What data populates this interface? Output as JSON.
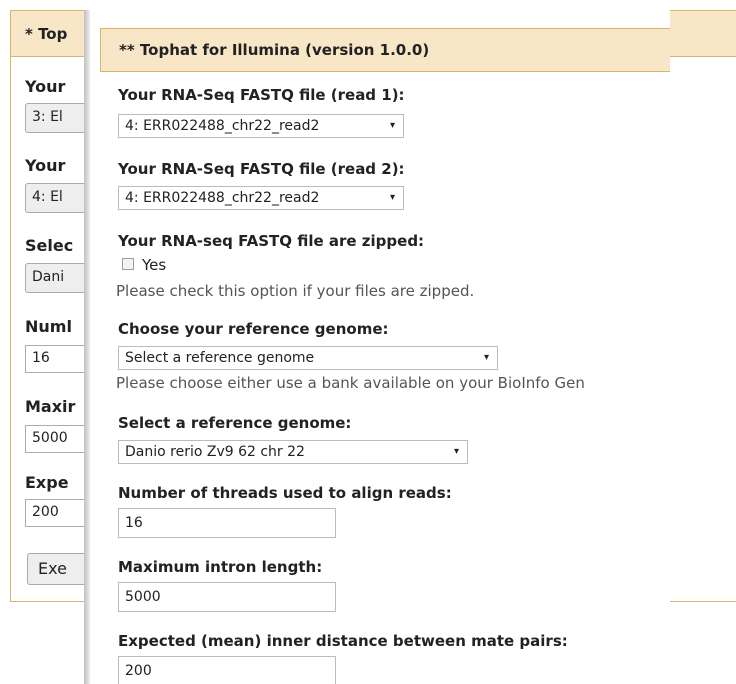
{
  "back_form": {
    "header": "* Top",
    "fields": [
      {
        "label": "Your",
        "value": "3: El"
      },
      {
        "label": "Your",
        "value": "4: El"
      },
      {
        "label": "Selec",
        "value": "Dani"
      },
      {
        "label": "Numl",
        "value": "16"
      },
      {
        "label": "Maxir",
        "value": "5000"
      },
      {
        "label": "Expe",
        "value": "200"
      }
    ],
    "execute_label": "Exe"
  },
  "front_form": {
    "header": "** Tophat for Illumina (version 1.0.0)",
    "read1": {
      "label": "Your RNA-Seq FASTQ file (read 1):",
      "value": "4: ERR022488_chr22_read2"
    },
    "read2": {
      "label": "Your RNA-Seq FASTQ file (read 2):",
      "value": "4: ERR022488_chr22_read2"
    },
    "zipped": {
      "label": "Your RNA-seq FASTQ file are zipped:",
      "checkbox_label": "Yes",
      "help": "Please check this option if your files are zipped."
    },
    "choose_ref": {
      "label": "Choose your reference genome:",
      "value": "Select a reference genome",
      "help": "Please choose either use a bank available on your BioInfo Gen"
    },
    "select_ref": {
      "label": "Select a reference genome:",
      "value": "Danio rerio Zv9 62 chr 22"
    },
    "threads": {
      "label": "Number of threads used to align reads:",
      "value": "16"
    },
    "intron": {
      "label": "Maximum intron length:",
      "value": "5000"
    },
    "inner_distance": {
      "label": "Expected (mean) inner distance between mate pairs:",
      "value": "200"
    }
  },
  "icons": {
    "dropdown": "▾"
  }
}
